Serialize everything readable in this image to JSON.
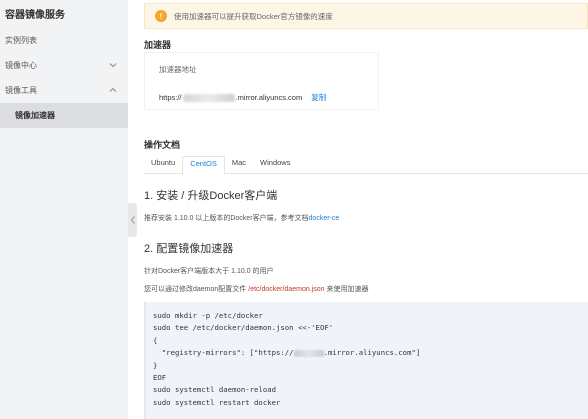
{
  "sidebar": {
    "title": "容器镜像服务",
    "items": [
      {
        "label": "实例列表"
      },
      {
        "label": "镜像中心"
      },
      {
        "label": "镜像工具"
      },
      {
        "label": "镜像加速器"
      }
    ]
  },
  "notice": {
    "text": "使用加速器可以提升获取Docker官方镜像的速度"
  },
  "accelerator": {
    "section_title": "加速器",
    "field_label": "加速器地址",
    "url_prefix": "https://",
    "url_suffix": ".mirror.aliyuncs.com",
    "copy_label": "复制"
  },
  "docs": {
    "section_title": "操作文档",
    "tabs": [
      "Ubuntu",
      "CentOS",
      "Mac",
      "Windows"
    ],
    "active_tab": "CentOS",
    "step1": {
      "title": "1. 安装 / 升级Docker客户端",
      "text": "推荐安装 1.10.0 以上版本的Docker客户端，参考文档",
      "link": "docker-ce"
    },
    "step2": {
      "title": "2. 配置镜像加速器",
      "line1": "针对Docker客户端版本大于 1.10.0 的用户",
      "line2_pre": "您可以通过修改daemon配置文件 ",
      "line2_path": "/etc/docker/daemon.json",
      "line2_post": " 来使用加速器"
    },
    "code": {
      "l1": "sudo mkdir -p /etc/docker",
      "l2": "sudo tee /etc/docker/daemon.json <<-'EOF'",
      "l3": "{",
      "l4_pre": "  \"registry-mirrors\": [\"https://",
      "l4_post": ".mirror.aliyuncs.com\"]",
      "l5": "}",
      "l6": "EOF",
      "l7": "sudo systemctl daemon-reload",
      "l8": "sudo systemctl restart docker"
    }
  },
  "colors": {
    "accent": "#1a7ed6",
    "warning": "#f5a623",
    "sidebar_bg": "#f2f3f5",
    "code_bg": "#f0f4fa"
  }
}
